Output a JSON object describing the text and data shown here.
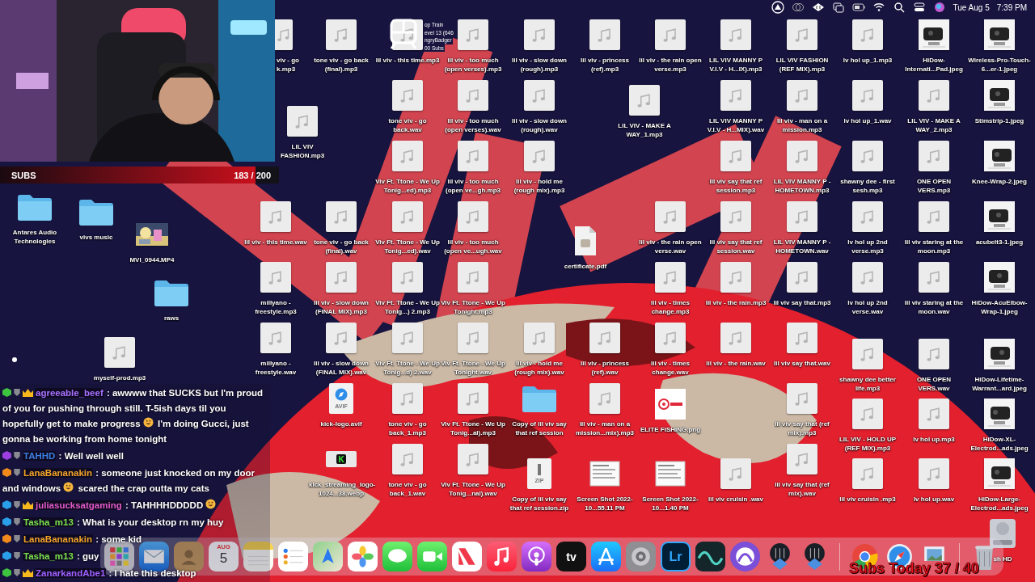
{
  "menu_bar": {
    "status_icons": [
      {
        "kind": "triangle"
      },
      {
        "kind": "rings"
      },
      {
        "kind": "diamond"
      },
      {
        "kind": "windows"
      },
      {
        "kind": "battery"
      },
      {
        "kind": "wifi"
      },
      {
        "kind": "search"
      },
      {
        "kind": "toggles"
      },
      {
        "kind": "orb"
      }
    ],
    "date": "Tue Aug 5",
    "time": "7:39 PM"
  },
  "subs_goal": {
    "label": "SUBS",
    "count": "183 / 200",
    "level": 0.915
  },
  "hype_train": {
    "lines": [
      "op Train",
      "evel 13 (646",
      "ngryBadger",
      "00 Subs"
    ]
  },
  "desktop": {
    "items": [
      {
        "label": "viv - go\nk.mp3",
        "kind": "audio"
      },
      {
        "label": "tone viv - go back (final).mp3",
        "kind": "audio"
      },
      {
        "label": "lil viv - this time.mp3",
        "kind": "audio"
      },
      {
        "label": "lil viv - too much (open verses).mp3",
        "kind": "audio"
      },
      {
        "label": "lil viv - slow down (rough).mp3",
        "kind": "audio"
      },
      {
        "label": "lil viv - princess (ref).mp3",
        "kind": "audio"
      },
      {
        "label": "lil viv - the rain open verse.mp3",
        "kind": "audio"
      },
      {
        "label": "LIL VIV MANNY P V.I.V - H...IX).mp3",
        "kind": "audio"
      },
      {
        "label": "LIL VIV FASHION (REF MIX).mp3",
        "kind": "audio"
      },
      {
        "label": "lv hol up_1.mp3",
        "kind": "audio"
      },
      {
        "label": "HiDow-Internati...Pad.jpeg"
      },
      {
        "label": "Wireless-Pro-Touch-6...er-1.jpeg"
      },
      {
        "label": "LIL VIV FASHION.mp3",
        "kind": "audio"
      },
      {
        "label": "tone viv - go back.wav",
        "kind": "audio"
      },
      {
        "label": "lil viv - too much (open verses).wav",
        "kind": "audio"
      },
      {
        "label": "lil viv - slow down (rough).wav",
        "kind": "audio"
      },
      {
        "label": "LIL VIV - MAKE A WAY_1.mp3",
        "kind": "audio"
      },
      {
        "label": "LIL VIV MANNY P V.I.V - H...MIX).wav",
        "kind": "audio"
      },
      {
        "label": "lil viv - man on a mission.mp3",
        "kind": "audio"
      },
      {
        "label": "lv hol up_1.wav",
        "kind": "audio"
      },
      {
        "label": "LIL VIV - MAKE A WAY_2.mp3",
        "kind": "audio"
      },
      {
        "label": "Stimstrip-1.jpeg"
      },
      {
        "label": "Viv Ft. Ttone - We Up Tonig...ed).mp3",
        "kind": "audio"
      },
      {
        "label": "lil viv - too much (open ve...gh.mp3",
        "kind": "audio"
      },
      {
        "label": "lil viv - hold me (rough mix).mp3",
        "kind": "audio"
      },
      {
        "label": "lil viv say that ref session.mp3",
        "kind": "audio"
      },
      {
        "label": "LIL VIV MANNY P - HOMETOWN.mp3",
        "kind": "audio"
      },
      {
        "label": "shawny dee - first sesh.mp3",
        "kind": "audio"
      },
      {
        "label": "ONE OPEN VERS.mp3",
        "kind": "audio"
      },
      {
        "label": "Knee-Wrap-2.jpeg"
      },
      {
        "label": "lil viv - this time.wav",
        "kind": "audio"
      },
      {
        "label": "tone viv - go back (final).wav",
        "kind": "audio"
      },
      {
        "label": "Viv Ft. Ttone - We Up Tonig...ed).wav",
        "kind": "audio"
      },
      {
        "label": "lil viv - too much (open ve...ugh.wav",
        "kind": "audio"
      },
      {
        "label": "certificate.pdf",
        "kind": "pdf"
      },
      {
        "label": "lil viv - the rain open verse.wav",
        "kind": "audio"
      },
      {
        "label": "lil viv say that ref session.wav",
        "kind": "audio"
      },
      {
        "label": "LIL VIV MANNY P - HOMETOWN.wav",
        "kind": "audio"
      },
      {
        "label": "lv hol up 2nd verse.mp3",
        "kind": "audio"
      },
      {
        "label": "lil viv staring at the moon.mp3",
        "kind": "audio"
      },
      {
        "label": "acubelt3-1.jpeg"
      },
      {
        "label": "millyano - freestyle.mp3",
        "kind": "audio"
      },
      {
        "label": "lil viv - slow down (FINAL MIX).mp3",
        "kind": "audio"
      },
      {
        "label": "Viv Ft. Ttone - We Up Tonig...) 2.mp3",
        "kind": "audio"
      },
      {
        "label": "Viv Ft. Ttone - We Up Tonight.mp3",
        "kind": "audio"
      },
      {
        "label": "lil viv - times change.mp3",
        "kind": "audio"
      },
      {
        "label": "lil viv - the rain.mp3",
        "kind": "audio"
      },
      {
        "label": "lil viv say that.mp3",
        "kind": "audio"
      },
      {
        "label": "lv hol up 2nd verse.wav",
        "kind": "audio"
      },
      {
        "label": "lil viv staring at the moon.wav",
        "kind": "audio"
      },
      {
        "label": "HiDow-AcuElbow-Wrap-1.jpeg"
      },
      {
        "label": "millyano - freestyle.wav",
        "kind": "audio"
      },
      {
        "label": "lil viv - slow down (FINAL MIX).wav",
        "kind": "audio"
      },
      {
        "label": "Viv Ft. Ttone - We Up Tonig...d) 2.wav",
        "kind": "audio"
      },
      {
        "label": "Viv Ft. Ttone - We Up Tonight.wav",
        "kind": "audio"
      },
      {
        "label": "lil viv - hold me (rough mix).wav",
        "kind": "audio"
      },
      {
        "label": "lil viv - princess (ref).wav",
        "kind": "audio"
      },
      {
        "label": "lil viv - times change.wav",
        "kind": "audio"
      },
      {
        "label": "lil viv - the rain.wav",
        "kind": "audio"
      },
      {
        "label": "lil viv say that.wav",
        "kind": "audio"
      },
      {
        "label": "shawny dee better life.mp3",
        "kind": "audio"
      },
      {
        "label": "ONE OPEN VERS.wav",
        "kind": "audio"
      },
      {
        "label": "HiDow-Lifetime-Warrant...ard.jpeg"
      },
      {
        "label": "kick-logo.avif",
        "kind": "avif",
        "badge": "AVIF"
      },
      {
        "label": "tone viv - go back_1.mp3",
        "kind": "audio"
      },
      {
        "label": "Viv Ft. Ttone - We Up Tonig...al).mp3",
        "kind": "audio"
      },
      {
        "label": "Copy of lil viv say that ref session",
        "kind": "folder"
      },
      {
        "label": "lil viv - man on a mission...mix).mp3",
        "kind": "audio"
      },
      {
        "label": "ELITE FISHING.png",
        "kind": "logo"
      },
      {
        "label": "lil viv say that (ref mix).mp3",
        "kind": "audio"
      },
      {
        "label": "LIL VIV - HOLD UP (REF MIX).mp3",
        "kind": "audio"
      },
      {
        "label": "lv hol up.mp3",
        "kind": "audio"
      },
      {
        "label": "HiDow-XL-Electrod...ads.jpeg"
      },
      {
        "label": "kick_streaming_logo-1024...38.webp",
        "kind": "webp",
        "badge": "K"
      },
      {
        "label": "tone viv - go back_1.wav",
        "kind": "audio"
      },
      {
        "label": "Viv Ft. Ttone - We Up Tonig...nal).wav",
        "kind": "audio"
      },
      {
        "label": "Copy of lil viv say that ref session.zip",
        "kind": "zip",
        "badge": "ZIP"
      },
      {
        "label": "Screen Shot 2022-10...55.11 PM",
        "kind": "screenshot"
      },
      {
        "label": "Screen Shot 2022-10...1.40 PM",
        "kind": "screenshot"
      },
      {
        "label": "lil viv cruisin .wav",
        "kind": "audio"
      },
      {
        "label": "lil viv say that (ref mix).wav",
        "kind": "audio"
      },
      {
        "label": "lil viv cruisin .mp3",
        "kind": "audio"
      },
      {
        "label": "lv hol up.wav",
        "kind": "audio"
      },
      {
        "label": "HiDow-Large-Electrod...ads.jpeg"
      },
      {
        "label": "Antares Audio Technologies",
        "kind": "folder"
      },
      {
        "label": "vivs music",
        "kind": "folder"
      },
      {
        "label": "MVI_0944.MP4",
        "kind": "video"
      },
      {
        "label": "raws",
        "kind": "folder"
      },
      {
        "label": "myself-prod.mp3",
        "kind": "audio"
      },
      {
        "label": "sh HD",
        "kind": "disk"
      }
    ]
  },
  "dock": {
    "items": [
      {
        "kind": "launchpad"
      },
      {
        "kind": "mail"
      },
      {
        "kind": "contacts"
      },
      {
        "kind": "calendar",
        "month": "AUG",
        "day": "5"
      },
      {
        "kind": "notes"
      },
      {
        "kind": "reminders"
      },
      {
        "kind": "maps"
      },
      {
        "kind": "photos"
      },
      {
        "kind": "messages"
      },
      {
        "kind": "facetime"
      },
      {
        "kind": "news"
      },
      {
        "kind": "music"
      },
      {
        "kind": "podcasts"
      },
      {
        "kind": "tv",
        "text": "tv"
      },
      {
        "kind": "appstore"
      },
      {
        "kind": "settings"
      },
      {
        "kind": "lightroom",
        "text": "Lr"
      },
      {
        "kind": "wave"
      },
      {
        "kind": "protools"
      },
      {
        "kind": "mixer"
      },
      {
        "kind": "mixer"
      },
      {
        "kind": "separator"
      },
      {
        "kind": "chrome"
      },
      {
        "kind": "safari"
      },
      {
        "kind": "preview"
      },
      {
        "kind": "separator"
      },
      {
        "kind": "trash"
      }
    ]
  },
  "chat": {
    "messages": [
      {
        "user": "agreeable_beef",
        "color": "#a970ff",
        "badge": {
          "color": "#3ec43e"
        },
        "crown": true,
        "parts": [
          {
            "kind": "text",
            "text": ": awwww that SUCKS but I'm proud"
          },
          {
            "kind": "text",
            "text": "of you for pushing through still. T-5ish days til you"
          },
          {
            "kind": "text",
            "text": "hopefully get to make progress"
          },
          {
            "kind": "emote"
          },
          {
            "kind": "text",
            "text": "I'm doing Gucci, just"
          },
          {
            "kind": "text",
            "text": "gonna be working from home tonight"
          }
        ]
      },
      {
        "user": "TAHHD",
        "color": "#3c7ee0",
        "badge": {
          "color": "#9b3fe0"
        },
        "crown": false,
        "parts": [
          {
            "kind": "text",
            "text": ": Well well well"
          }
        ]
      },
      {
        "user": "LanaBananakin",
        "color": "#f4a428",
        "badge": {
          "color": "#f08a1c"
        },
        "crown": false,
        "parts": [
          {
            "kind": "text",
            "text": ": someone just knocked on my door"
          },
          {
            "kind": "text",
            "text": "and windows"
          },
          {
            "kind": "emote"
          },
          {
            "kind": "text",
            "text": "scared the crap outta my cats"
          }
        ]
      },
      {
        "user": "juliasucksatgaming",
        "color": "#e35ac8",
        "badge": {
          "color": "#2a9ee8"
        },
        "crown": true,
        "parts": [
          {
            "kind": "text",
            "text": ": TAHHHHDDDDD"
          },
          {
            "kind": "emote"
          }
        ]
      },
      {
        "user": "Tasha_m13",
        "color": "#7be04a",
        "badge": {
          "color": "#2a9ee8"
        },
        "crown": false,
        "parts": [
          {
            "kind": "text",
            "text": ": What is your desktop rn my huy"
          }
        ]
      },
      {
        "user": "LanaBananakin",
        "color": "#f4a428",
        "badge": {
          "color": "#f08a1c"
        },
        "crown": false,
        "parts": [
          {
            "kind": "text",
            "text": ": some kid"
          }
        ]
      },
      {
        "user": "Tasha_m13",
        "color": "#7be04a",
        "badge": {
          "color": "#2a9ee8"
        },
        "crown": false,
        "parts": [
          {
            "kind": "text",
            "text": ": guy"
          }
        ]
      },
      {
        "user": "ZanarkandAbe1",
        "color": "#a060ff",
        "badge": {
          "color": "#3ec43e"
        },
        "crown": true,
        "parts": [
          {
            "kind": "text",
            "text": ": I hate this desktop"
          }
        ]
      }
    ]
  },
  "subs_today": {
    "text": "Subs Today 37 / 40"
  }
}
